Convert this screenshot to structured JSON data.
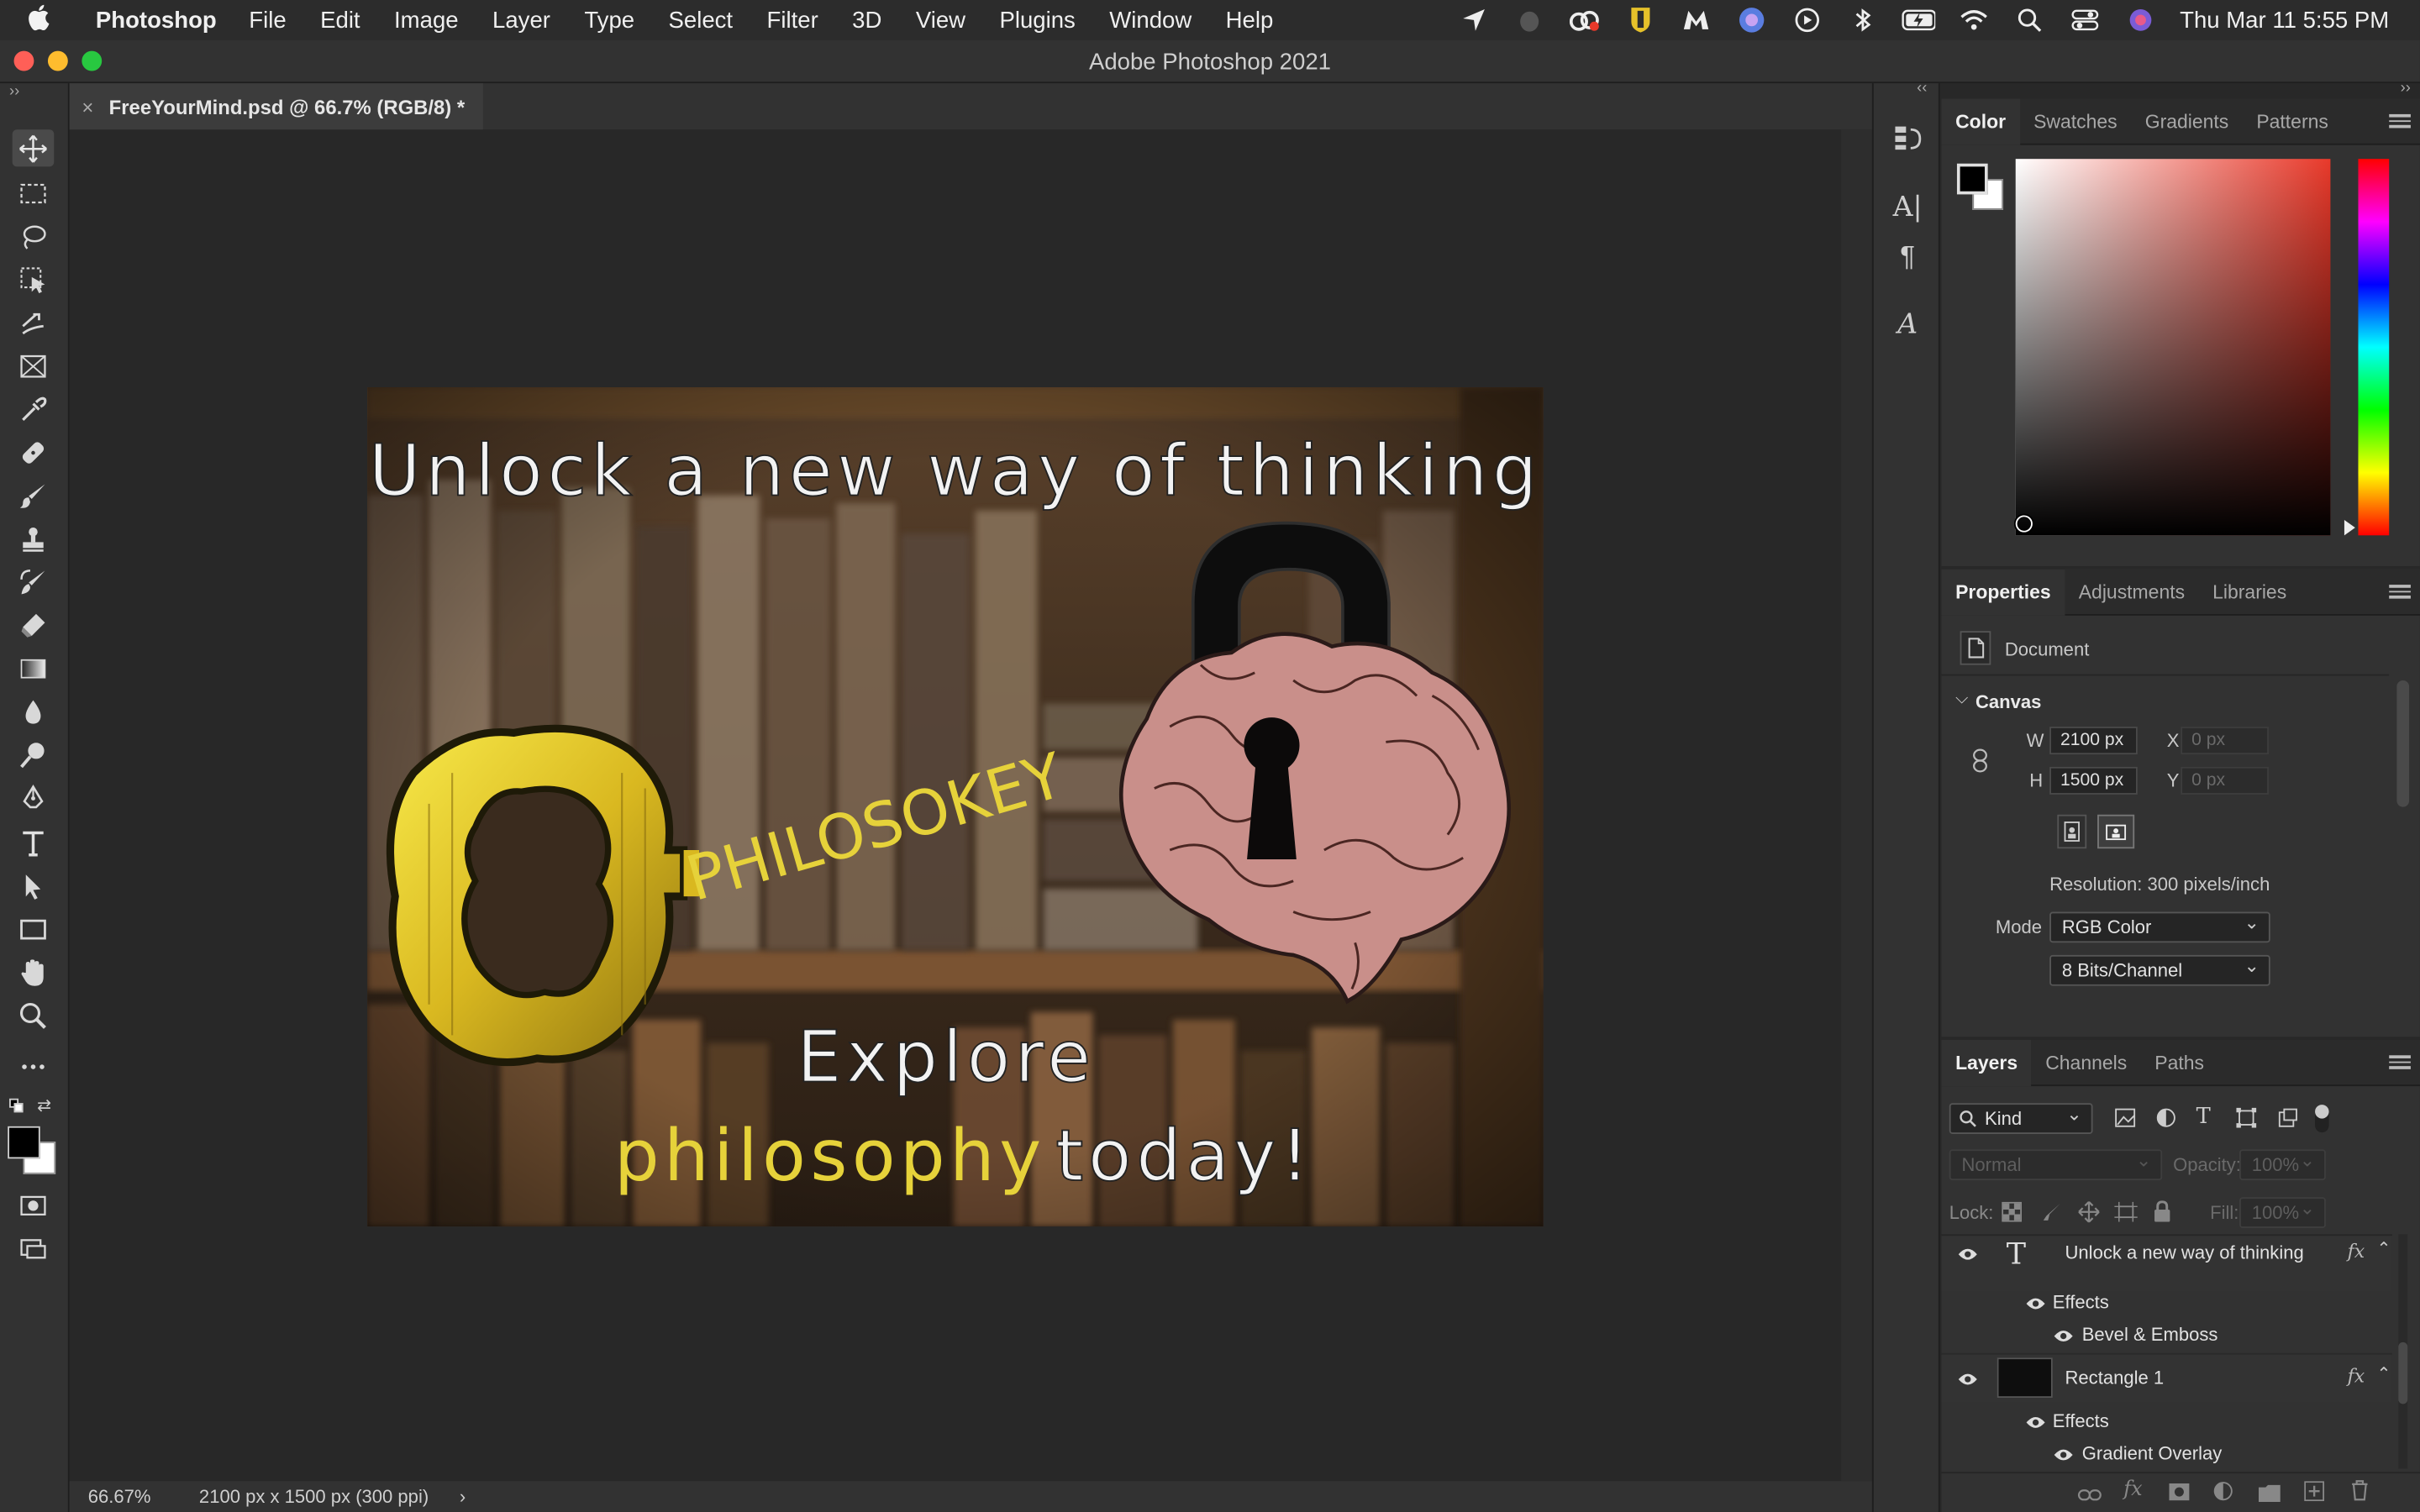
{
  "menubar": {
    "app_name": "Photoshop",
    "items": [
      "File",
      "Edit",
      "Image",
      "Layer",
      "Type",
      "Select",
      "Filter",
      "3D",
      "View",
      "Plugins",
      "Window",
      "Help"
    ],
    "clock": "Thu Mar 11  5:55 PM"
  },
  "window": {
    "title": "Adobe Photoshop 2021",
    "close_color": "#ff5f57",
    "minimize_color": "#febc2e",
    "zoom_color": "#28c840"
  },
  "document_tab": {
    "close_glyph": "×",
    "label": "FreeYourMind.psd @ 66.7% (RGB/8) *"
  },
  "toolbar": {
    "tools": [
      "move-tool-icon",
      "marquee-tool-icon",
      "lasso-tool-icon",
      "object-select-tool-icon",
      "crop-tool-icon",
      "frame-tool-icon",
      "eyedropper-tool-icon",
      "healing-brush-tool-icon",
      "brush-tool-icon",
      "clone-stamp-tool-icon",
      "history-brush-tool-icon",
      "eraser-tool-icon",
      "gradient-tool-icon",
      "blur-tool-icon",
      "dodge-tool-icon",
      "pen-tool-icon",
      "type-tool-icon",
      "path-select-tool-icon",
      "rectangle-tool-icon",
      "hand-tool-icon",
      "zoom-tool-icon",
      "more-tools-icon"
    ],
    "foreground_color": "#000000",
    "background_color": "#ffffff"
  },
  "artwork": {
    "headline": "Unlock a new way of thinking",
    "key_word": "PHILOSOKEY",
    "line1": "Explore",
    "line2_highlight": "philosophy",
    "line2_rest": "today!",
    "highlight_color": "#e6d23a",
    "text_color": "#f2f2f2"
  },
  "status": {
    "zoom": "66.67%",
    "doc_info": "2100 px x 1500 px (300 ppi)",
    "arrow": "›"
  },
  "color_panel": {
    "tabs": [
      "Color",
      "Swatches",
      "Gradients",
      "Patterns"
    ],
    "active_tab": "Color",
    "picker_hue": "#e8392a"
  },
  "properties_panel": {
    "tabs": [
      "Properties",
      "Adjustments",
      "Libraries"
    ],
    "active_tab": "Properties",
    "doc_label": "Document",
    "section": "Canvas",
    "w_label": "W",
    "w_value": "2100 px",
    "h_label": "H",
    "h_value": "1500 px",
    "x_label": "X",
    "x_placeholder": "0 px",
    "y_label": "Y",
    "y_placeholder": "0 px",
    "resolution": "Resolution: 300 pixels/inch",
    "mode_label": "Mode",
    "mode_value": "RGB Color",
    "depth_value": "8 Bits/Channel"
  },
  "layers_panel": {
    "tabs": [
      "Layers",
      "Channels",
      "Paths"
    ],
    "active_tab": "Layers",
    "filter_kind": "Kind",
    "blend_mode": "Normal",
    "opacity_label": "Opacity:",
    "opacity_value": "100%",
    "lock_label": "Lock:",
    "fill_label": "Fill:",
    "fill_value": "100%",
    "fx_glyph": "fx",
    "layers": [
      {
        "name": "Unlock a new way of thinking",
        "kind": "type",
        "effects_label": "Effects",
        "effect": "Bevel & Emboss"
      },
      {
        "name": "Rectangle 1",
        "kind": "shape",
        "effects_label": "Effects",
        "effect": "Gradient Overlay"
      }
    ]
  }
}
